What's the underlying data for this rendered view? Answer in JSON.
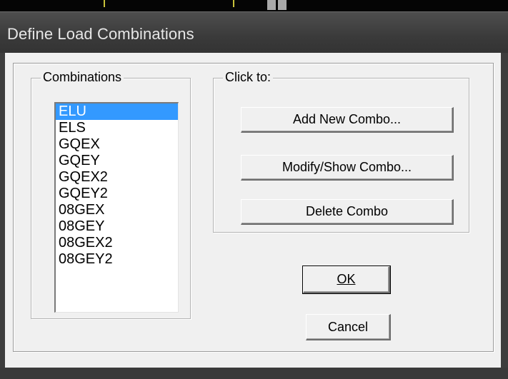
{
  "window": {
    "title": "Define Load Combinations"
  },
  "combinations": {
    "legend": "Combinations",
    "items": [
      "ELU",
      "ELS",
      "GQEX",
      "GQEY",
      "GQEX2",
      "GQEY2",
      "08GEX",
      "08GEY",
      "08GEX2",
      "08GEY2"
    ],
    "selected": "ELU"
  },
  "click_to": {
    "legend": "Click to:",
    "add_label": "Add New Combo...",
    "modify_label": "Modify/Show Combo...",
    "delete_label": "Delete Combo"
  },
  "dialog_buttons": {
    "ok_label": "OK",
    "cancel_label": "Cancel"
  },
  "colors": {
    "selection": "#3399ff",
    "dialog_bg": "#f0f0f0",
    "title_bar": "#3a3a3a"
  }
}
